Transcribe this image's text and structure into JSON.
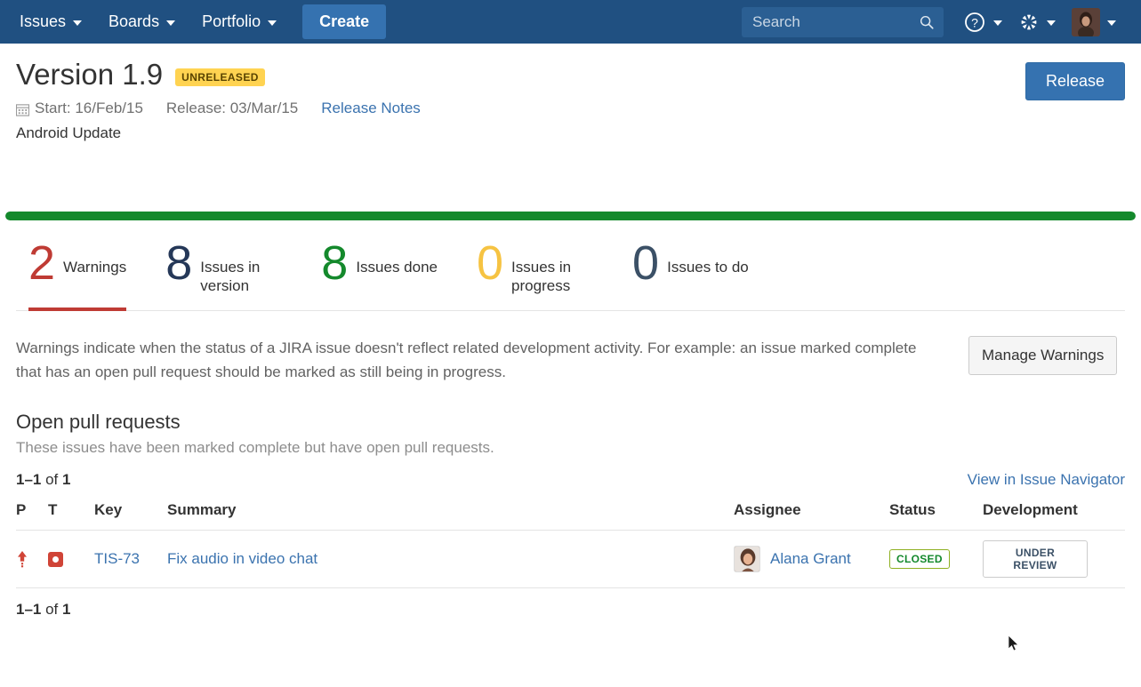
{
  "navbar": {
    "items": [
      {
        "label": "Issues",
        "has_caret": true
      },
      {
        "label": "Boards",
        "has_caret": true
      },
      {
        "label": "Portfolio",
        "has_caret": true
      }
    ],
    "create_label": "Create",
    "search_placeholder": "Search",
    "search_value": "",
    "help_icon": "question-circle-icon",
    "settings_icon": "gear-icon",
    "avatar_icon": "user-avatar",
    "background_color": "#205081",
    "create_button_color": "#3572b0"
  },
  "version": {
    "title": "Version 1.9",
    "status_badge": "UNRELEASED",
    "badge_color": "#ffd351",
    "calendar_icon": "calendar-icon",
    "start_label": "Start: 16/Feb/15",
    "release_label": "Release: 03/Mar/15",
    "release_notes_link": "Release Notes",
    "description": "Android Update",
    "release_button": "Release"
  },
  "progress": {
    "percent": 100,
    "fill_color": "#14892c"
  },
  "stats": [
    {
      "value": "2",
      "label": "Warnings",
      "color": "#bf3b34",
      "active": true
    },
    {
      "value": "8",
      "label": "Issues in version",
      "color": "#253858",
      "active": false
    },
    {
      "value": "8",
      "label": "Issues done",
      "color": "#14892c",
      "active": false
    },
    {
      "value": "0",
      "label": "Issues in progress",
      "color": "#f6c342",
      "active": false
    },
    {
      "value": "0",
      "label": "Issues to do",
      "color": "#3b5066",
      "active": false
    }
  ],
  "warnings": {
    "description": "Warnings indicate when the status of a JIRA issue doesn't reflect related development activity. For example: an issue marked complete that has an open pull request should be marked as still being in progress.",
    "manage_button": "Manage Warnings"
  },
  "open_pull_requests": {
    "title": "Open pull requests",
    "subtitle": "These issues have been marked complete but have open pull requests.",
    "pager_range": "1–1",
    "pager_of": " of ",
    "pager_total": "1",
    "navigator_link": "View in Issue Navigator",
    "columns": [
      "P",
      "T",
      "Key",
      "Summary",
      "Assignee",
      "Status",
      "Development"
    ],
    "rows": [
      {
        "priority_icon": "priority-major-up-arrow-icon",
        "type_icon": "bug-icon",
        "key": "TIS-73",
        "summary": "Fix audio in video chat",
        "assignee": "Alana Grant",
        "assignee_avatar": "user-avatar",
        "status": "CLOSED",
        "status_color": "#14892c",
        "development": "UNDER REVIEW"
      }
    ],
    "footer_range": "1–1",
    "footer_of": " of ",
    "footer_total": "1"
  }
}
